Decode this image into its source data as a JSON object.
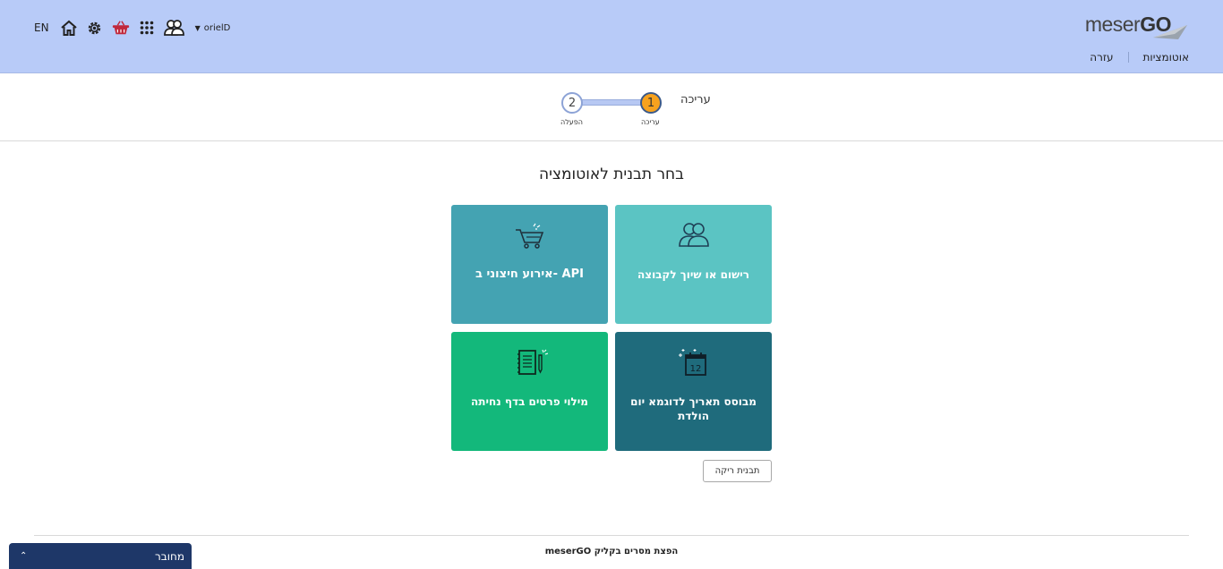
{
  "header": {
    "logo_text_light": "meser",
    "logo_text_bold": "GO",
    "nav": [
      {
        "label": "אוטומציות"
      },
      {
        "label": "עזרה"
      }
    ],
    "lang": "EN",
    "username": "orielD",
    "icons": [
      "home-icon",
      "gear-icon",
      "basket-icon",
      "apps-grid-icon",
      "users-icon"
    ],
    "bg_color": "#b8cbf8"
  },
  "steps": {
    "title": "עריכה",
    "items": [
      {
        "number": "1",
        "label": "עריכה",
        "active": true
      },
      {
        "number": "2",
        "label": "הפעלה",
        "active": false
      }
    ],
    "active_color": "#f7a21e"
  },
  "main": {
    "title": "בחר תבנית לאוטומציה",
    "tiles": [
      {
        "label": "רישום או שיוך לקבוצה",
        "icon": "group-icon",
        "color": "#5bc4c3"
      },
      {
        "label": "אירוע חיצוני ב- API",
        "icon": "cart-icon",
        "color": "#44a3b2"
      },
      {
        "label": "מבוסס תאריך לדוגמא יום הולדת",
        "icon": "calendar-icon",
        "color": "#1f6b7c",
        "calendar_day": "12"
      },
      {
        "label": "מילוי פרטים בדף נחיתה",
        "icon": "notebook-pen-icon",
        "color": "#13b87b"
      }
    ],
    "empty_template_label": "תבנית ריקה"
  },
  "footer": {
    "text": "meserGO הפצת מסרים בקליק"
  },
  "status_bar": {
    "label": "מחובר",
    "color": "#1e3768"
  }
}
